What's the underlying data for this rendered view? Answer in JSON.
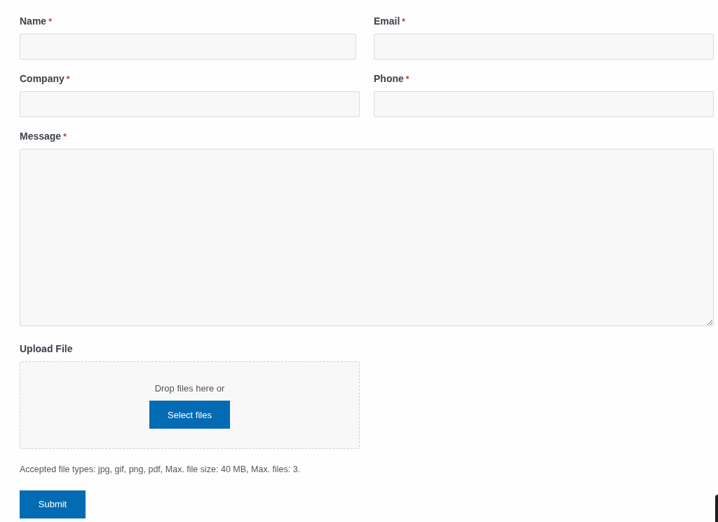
{
  "fields_row_1": [
    {
      "label": "Name",
      "required_mark": "*"
    },
    {
      "label": "Email",
      "required_mark": "*"
    }
  ],
  "fields_row_2": [
    {
      "label": "Company",
      "required_mark": "*"
    },
    {
      "label": "Phone",
      "required_mark": "*"
    }
  ],
  "message": {
    "label": "Message",
    "required_mark": "*"
  },
  "upload": {
    "label": "Upload File",
    "drop_text": "Drop files here or",
    "button": "Select files",
    "help": "Accepted file types: jpg, gif, png, pdf, Max. file size: 40 MB, Max. files: 3."
  },
  "submit": "Submit"
}
